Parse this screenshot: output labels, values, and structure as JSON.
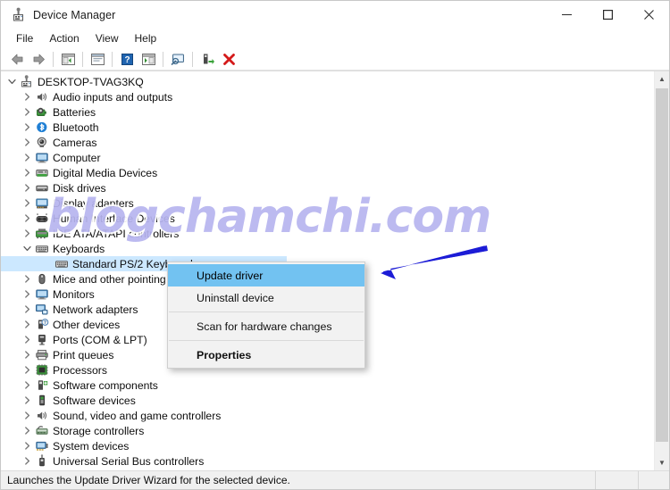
{
  "window": {
    "title": "Device Manager",
    "icon": "device-manager-icon",
    "controls": {
      "minimize": "—",
      "maximize": "□",
      "close": "✕"
    }
  },
  "menubar": {
    "items": [
      {
        "label": "File"
      },
      {
        "label": "Action"
      },
      {
        "label": "View"
      },
      {
        "label": "Help"
      }
    ]
  },
  "toolbar": {
    "buttons": [
      {
        "name": "back-button",
        "icon": "back-arrow-icon"
      },
      {
        "name": "forward-button",
        "icon": "forward-arrow-icon"
      },
      {
        "name": "separator-1",
        "icon": "separator"
      },
      {
        "name": "show-hide-console-tree-button",
        "icon": "console-tree-icon"
      },
      {
        "name": "separator-2",
        "icon": "separator"
      },
      {
        "name": "properties-button",
        "icon": "properties-window-icon"
      },
      {
        "name": "separator-3",
        "icon": "separator"
      },
      {
        "name": "help-button",
        "icon": "help-question-icon"
      },
      {
        "name": "action-pane-button",
        "icon": "action-pane-icon"
      },
      {
        "name": "separator-4",
        "icon": "separator"
      },
      {
        "name": "scan-hardware-changes-button",
        "icon": "scan-monitor-icon"
      },
      {
        "name": "separator-5",
        "icon": "separator"
      },
      {
        "name": "update-driver-button",
        "icon": "update-driver-icon"
      },
      {
        "name": "uninstall-device-button",
        "icon": "red-x-icon"
      }
    ]
  },
  "tree": {
    "nodes": [
      {
        "label": "DESKTOP-TVAG3KQ",
        "depth": 0,
        "twisty": "expanded",
        "icon": "computer-root-icon",
        "selected": false
      },
      {
        "label": "Audio inputs and outputs",
        "depth": 1,
        "twisty": "collapsed",
        "icon": "speaker-icon",
        "selected": false
      },
      {
        "label": "Batteries",
        "depth": 1,
        "twisty": "collapsed",
        "icon": "battery-icon",
        "selected": false
      },
      {
        "label": "Bluetooth",
        "depth": 1,
        "twisty": "collapsed",
        "icon": "bluetooth-icon",
        "selected": false
      },
      {
        "label": "Cameras",
        "depth": 1,
        "twisty": "collapsed",
        "icon": "camera-icon",
        "selected": false
      },
      {
        "label": "Computer",
        "depth": 1,
        "twisty": "collapsed",
        "icon": "monitor-icon",
        "selected": false
      },
      {
        "label": "Digital Media Devices",
        "depth": 1,
        "twisty": "collapsed",
        "icon": "media-device-icon",
        "selected": false
      },
      {
        "label": "Disk drives",
        "depth": 1,
        "twisty": "collapsed",
        "icon": "disk-drive-icon",
        "selected": false
      },
      {
        "label": "Display adapters",
        "depth": 1,
        "twisty": "collapsed",
        "icon": "display-adapter-icon",
        "selected": false
      },
      {
        "label": "Human Interface Devices",
        "depth": 1,
        "twisty": "collapsed",
        "icon": "hid-icon",
        "selected": false
      },
      {
        "label": "IDE ATA/ATAPI controllers",
        "depth": 1,
        "twisty": "collapsed",
        "icon": "ide-controller-icon",
        "selected": false
      },
      {
        "label": "Keyboards",
        "depth": 1,
        "twisty": "expanded",
        "icon": "keyboard-icon",
        "selected": false
      },
      {
        "label": "Standard PS/2 Keyboard",
        "depth": 2,
        "twisty": "none",
        "icon": "keyboard-device-icon",
        "selected": true
      },
      {
        "label": "Mice and other pointing devices",
        "depth": 1,
        "twisty": "collapsed",
        "icon": "mouse-icon",
        "selected": false
      },
      {
        "label": "Monitors",
        "depth": 1,
        "twisty": "collapsed",
        "icon": "monitor-icon",
        "selected": false
      },
      {
        "label": "Network adapters",
        "depth": 1,
        "twisty": "collapsed",
        "icon": "network-adapter-icon",
        "selected": false
      },
      {
        "label": "Other devices",
        "depth": 1,
        "twisty": "collapsed",
        "icon": "other-device-icon",
        "selected": false
      },
      {
        "label": "Ports (COM & LPT)",
        "depth": 1,
        "twisty": "collapsed",
        "icon": "port-icon",
        "selected": false
      },
      {
        "label": "Print queues",
        "depth": 1,
        "twisty": "collapsed",
        "icon": "printer-icon",
        "selected": false
      },
      {
        "label": "Processors",
        "depth": 1,
        "twisty": "collapsed",
        "icon": "processor-icon",
        "selected": false
      },
      {
        "label": "Software components",
        "depth": 1,
        "twisty": "collapsed",
        "icon": "software-component-icon",
        "selected": false
      },
      {
        "label": "Software devices",
        "depth": 1,
        "twisty": "collapsed",
        "icon": "software-device-icon",
        "selected": false
      },
      {
        "label": "Sound, video and game controllers",
        "depth": 1,
        "twisty": "collapsed",
        "icon": "sound-controller-icon",
        "selected": false
      },
      {
        "label": "Storage controllers",
        "depth": 1,
        "twisty": "collapsed",
        "icon": "storage-controller-icon",
        "selected": false
      },
      {
        "label": "System devices",
        "depth": 1,
        "twisty": "collapsed",
        "icon": "system-device-icon",
        "selected": false
      },
      {
        "label": "Universal Serial Bus controllers",
        "depth": 1,
        "twisty": "collapsed",
        "icon": "usb-controller-icon",
        "selected": false
      }
    ]
  },
  "context_menu": {
    "items": [
      {
        "label": "Update driver",
        "type": "item",
        "highlight": true,
        "bold": false
      },
      {
        "label": "Uninstall device",
        "type": "item",
        "highlight": false,
        "bold": false
      },
      {
        "label": "",
        "type": "separator",
        "highlight": false,
        "bold": false
      },
      {
        "label": "Scan for hardware changes",
        "type": "item",
        "highlight": false,
        "bold": false
      },
      {
        "label": "",
        "type": "separator",
        "highlight": false,
        "bold": false
      },
      {
        "label": "Properties",
        "type": "item",
        "highlight": false,
        "bold": true
      }
    ]
  },
  "statusbar": {
    "text": "Launches the Update Driver Wizard for the selected device."
  },
  "watermark": {
    "text": "blogchamchi.com"
  },
  "annotation": {
    "arrow_color": "#1a1ad6",
    "points_to": "Update driver"
  },
  "colors": {
    "selection_blue": "#cce8ff",
    "menu_highlight": "#72c2f1",
    "window_bg": "#ffffff",
    "statusbar_bg": "#f0f0f0",
    "watermark_purple": "#b7b5ef",
    "close_hover_red": "#e81123"
  }
}
